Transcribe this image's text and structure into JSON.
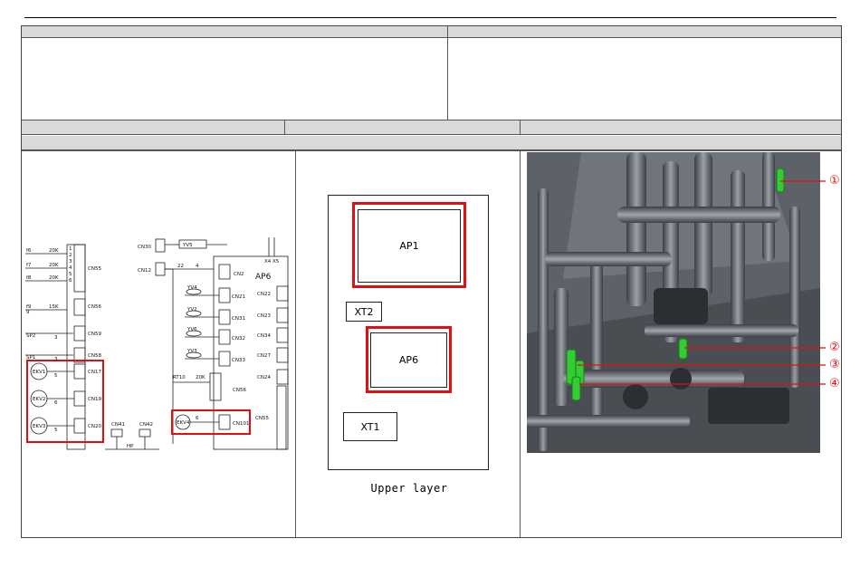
{
  "schematic": {
    "board_label": "AP6",
    "sensors": [
      {
        "name": "f6",
        "value": "20K"
      },
      {
        "name": "f7",
        "value": "20K"
      },
      {
        "name": "f8",
        "value": "20K"
      },
      {
        "name": "f9",
        "value": "15K"
      }
    ],
    "left_connectors": [
      "CN55",
      "CN56",
      "CN59",
      "CN58",
      "CN17",
      "CN19",
      "CN20"
    ],
    "expansion_valves": [
      "EKV1",
      "EKV2",
      "EKV3"
    ],
    "pin_labels": [
      "1",
      "2",
      "3",
      "4",
      "5",
      "6",
      "9",
      "3",
      "3",
      "5",
      "6",
      "5"
    ],
    "sp_labels": [
      "SP2",
      "SP1"
    ],
    "top_connectors": [
      "CN30",
      "CN12",
      "CN2"
    ],
    "yv5_label": "YV5",
    "cn12_wire": "22",
    "cn2_pin": "4",
    "x_terminals": "X4 X5",
    "solenoids": [
      {
        "connector": "CN21",
        "label": "YV4"
      },
      {
        "connector": "CN31",
        "label": "YV2"
      },
      {
        "connector": "CN32",
        "label": "YV6"
      },
      {
        "connector": "CN33",
        "label": "YV3"
      }
    ],
    "right_connectors": [
      "CN22",
      "CN23",
      "CN34",
      "CN27",
      "CN24",
      "CN55"
    ],
    "rt10": {
      "name": "RT10",
      "value": "20K",
      "connector": "CN56"
    },
    "ekv4": {
      "name": "EKV4",
      "pin": "6",
      "connector": "CN101"
    },
    "bottom_connectors": [
      "CN41",
      "CN42"
    ],
    "hp_label": "HP"
  },
  "layout_view": {
    "blocks": [
      "AP1",
      "XT2",
      "AP6",
      "XT1"
    ],
    "caption": "Upper layer"
  },
  "callouts": [
    "①",
    "②",
    "③",
    "④"
  ],
  "colors": {
    "highlight": "#e01010",
    "header_fill": "#d9d9d9",
    "component_green": "#33cc33"
  }
}
